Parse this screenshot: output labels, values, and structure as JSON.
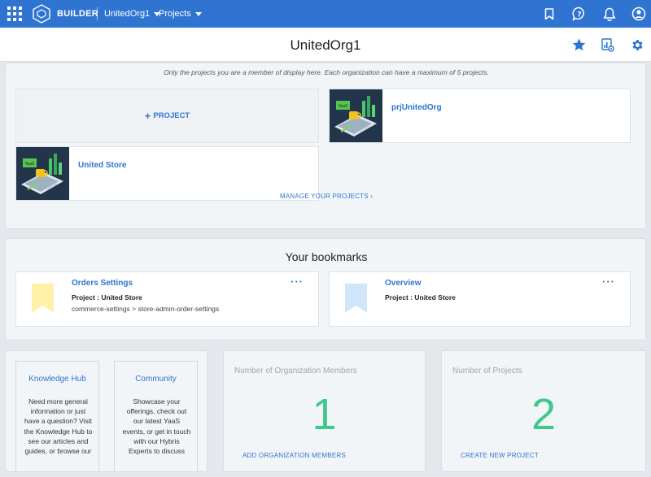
{
  "topbar": {
    "brand": "BUILDER",
    "org_selector": "UnitedOrg1",
    "projects_menu": "Projects",
    "color": "#2f74d0",
    "icons": [
      "apps-grid-icon",
      "builder-logo-icon",
      "bookmark-icon",
      "help-icon",
      "bell-icon",
      "user-icon"
    ]
  },
  "header": {
    "title": "UnitedOrg1",
    "icons": [
      "star-icon",
      "analytics-icon",
      "gear-icon"
    ]
  },
  "projects": {
    "note": "Only the projects you are a member of display here. Each organization can have a maximum of 5 projects.",
    "add_label": "PROJECT",
    "items": [
      {
        "name": "prjUnitedOrg"
      },
      {
        "name": "United Store"
      }
    ],
    "manage_link": "MANAGE YOUR PROJECTS ›"
  },
  "bookmarks": {
    "title": "Your bookmarks",
    "items": [
      {
        "title": "Orders Settings",
        "project": "Project : United Store",
        "path": "commerce-settings > store-admin-order-settings",
        "flag_color": "#fff0a8"
      },
      {
        "title": "Overview",
        "project": "Project : United Store",
        "path": "",
        "flag_color": "#cfe5f8"
      }
    ],
    "more_label": "···"
  },
  "help": {
    "knowledge": {
      "title": "Knowledge Hub",
      "body": "Need more general information or just have a question? Visit the Knowledge Hub to see our articles and guides, or browse our"
    },
    "community": {
      "title": "Community",
      "body": "Showcase your offerings, check out our latest YaaS events, or get in touch with our Hybris Experts to discuss"
    }
  },
  "stats": {
    "members": {
      "label": "Number of Organization Members",
      "value": "1",
      "link": "ADD ORGANIZATION MEMBERS"
    },
    "projects": {
      "label": "Number of Projects",
      "value": "2",
      "link": "CREATE NEW PROJECT"
    },
    "accent": "#3ec98b"
  }
}
